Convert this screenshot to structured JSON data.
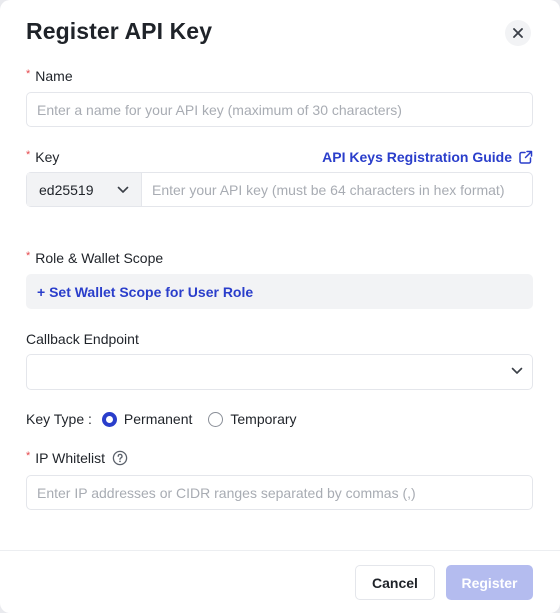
{
  "dialog": {
    "title": "Register API Key",
    "close_icon": "close-icon"
  },
  "name_field": {
    "label": "Name",
    "required_mark": "*",
    "value": "",
    "placeholder": "Enter a name for your API key (maximum of 30 characters)"
  },
  "key_field": {
    "label": "Key",
    "required_mark": "*",
    "guide_link": "API Keys Registration Guide",
    "guide_icon": "external-link-icon",
    "key_type_selected": "ed25519",
    "value": "",
    "placeholder": "Enter your API key (must be 64 characters in hex format)"
  },
  "scope_field": {
    "label": "Role & Wallet Scope",
    "required_mark": "*",
    "action": "+ Set Wallet Scope for User Role"
  },
  "callback_field": {
    "label": "Callback Endpoint",
    "value": ""
  },
  "key_type": {
    "label": "Key Type :",
    "options": [
      {
        "label": "Permanent",
        "selected": true
      },
      {
        "label": "Temporary",
        "selected": false
      }
    ]
  },
  "ip_field": {
    "label": "IP Whitelist",
    "required_mark": "*",
    "help_icon": "help-circle-icon",
    "value": "",
    "placeholder": "Enter IP addresses or CIDR ranges separated by commas (,)"
  },
  "footer": {
    "cancel_label": "Cancel",
    "register_label": "Register"
  },
  "colors": {
    "accent": "#2a3ecb",
    "required": "#e5484d",
    "register_disabled": "#b4bcef"
  }
}
